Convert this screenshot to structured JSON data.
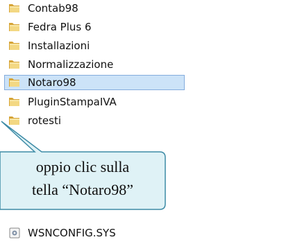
{
  "explorer": {
    "items": [
      {
        "type": "folder",
        "label": "Contab98",
        "selected": false
      },
      {
        "type": "folder",
        "label": "Fedra Plus 6",
        "selected": false
      },
      {
        "type": "folder",
        "label": "Installazioni",
        "selected": false
      },
      {
        "type": "folder",
        "label": "Normalizzazione",
        "selected": false
      },
      {
        "type": "folder",
        "label": "Notaro98",
        "selected": true
      },
      {
        "type": "folder",
        "label": "PluginStampaIVA",
        "selected": false
      },
      {
        "type": "folder",
        "label": "rotesti",
        "selected": false
      },
      {
        "type": "file",
        "label": "WSNCONFIG.SYS",
        "selected": false
      }
    ]
  },
  "callout": {
    "line1": "oppio clic sulla",
    "line2": "tella “Notaro98”"
  },
  "colors": {
    "folder_back": "#E3B84A",
    "folder_front": "#F3D883",
    "selection_fill": "#CCE3F8",
    "selection_border": "#84ACDD",
    "callout_fill": "#DFF2F6",
    "callout_border": "#3D8BA6"
  },
  "icons": {
    "folder": "folder-icon",
    "file": "system-file-icon"
  }
}
